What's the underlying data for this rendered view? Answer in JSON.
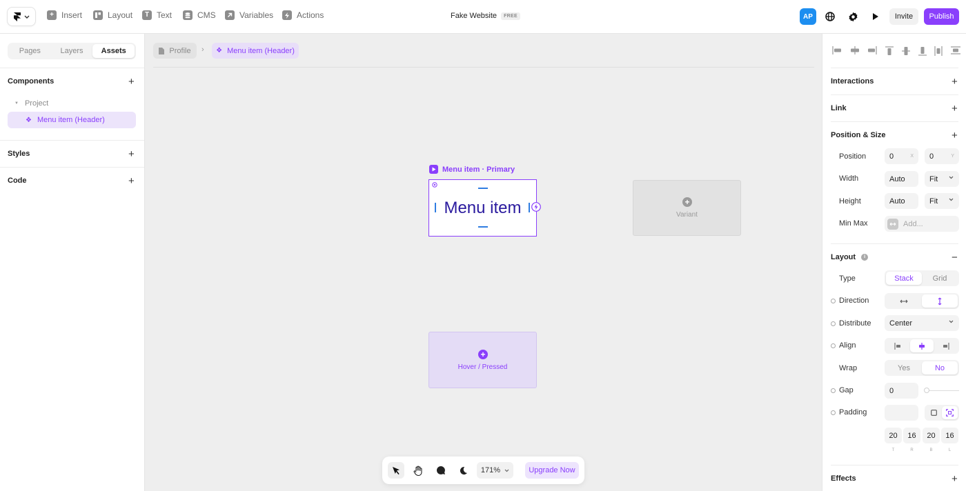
{
  "toolbar": {
    "insert": "Insert",
    "layout": "Layout",
    "text": "Text",
    "cms": "CMS",
    "variables": "Variables",
    "actions": "Actions"
  },
  "site": {
    "title": "Fake Website",
    "plan": "FREE"
  },
  "header_right": {
    "avatar": "AP",
    "invite": "Invite",
    "publish": "Publish"
  },
  "left_panel": {
    "tabs": [
      "Pages",
      "Layers",
      "Assets"
    ],
    "active_tab": "Assets",
    "sections": {
      "components": "Components",
      "styles": "Styles",
      "code": "Code"
    },
    "project": "Project",
    "component_item": "Menu item (Header)"
  },
  "canvas": {
    "breadcrumb": {
      "profile": "Profile",
      "component": "Menu item (Header)"
    },
    "frame_label": "Menu item · Primary",
    "primary_text": "Menu item",
    "variant_label": "Variant",
    "hover_label": "Hover / Pressed"
  },
  "bottom_bar": {
    "zoom": "171%",
    "upgrade": "Upgrade Now"
  },
  "right_panel": {
    "interactions": "Interactions",
    "link": "Link",
    "position_size": "Position & Size",
    "position_label": "Position",
    "position_x": "0",
    "position_y": "0",
    "x_suffix": "X",
    "y_suffix": "Y",
    "width_label": "Width",
    "width_value": "Auto",
    "width_mode": "Fit",
    "height_label": "Height",
    "height_value": "Auto",
    "height_mode": "Fit",
    "minmax_label": "Min Max",
    "minmax_placeholder": "Add...",
    "layout": "Layout",
    "type_label": "Type",
    "type_options": [
      "Stack",
      "Grid"
    ],
    "type_selected": "Stack",
    "direction_label": "Direction",
    "direction_selected": "vertical",
    "distribute_label": "Distribute",
    "distribute_value": "Center",
    "align_label": "Align",
    "align_selected": "center",
    "wrap_label": "Wrap",
    "wrap_options": [
      "Yes",
      "No"
    ],
    "wrap_selected": "No",
    "gap_label": "Gap",
    "gap_value": "0",
    "padding_label": "Padding",
    "padding_values": [
      "20",
      "16",
      "20",
      "16"
    ],
    "padding_sides": [
      "T",
      "R",
      "B",
      "L"
    ],
    "effects": "Effects"
  },
  "colors": {
    "accent": "#8a3ffc",
    "avatar": "#1d8ef0",
    "canvas": "#eeeeee"
  }
}
